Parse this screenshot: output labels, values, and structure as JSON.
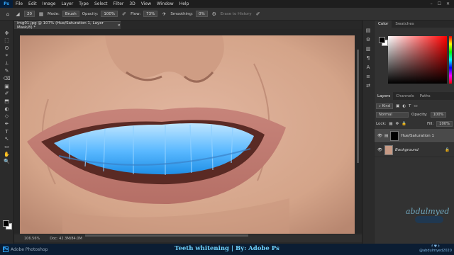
{
  "menubar": {
    "logo": "Ps",
    "items": [
      "File",
      "Edit",
      "Image",
      "Layer",
      "Type",
      "Select",
      "Filter",
      "3D",
      "View",
      "Window",
      "Help"
    ],
    "window_buttons": [
      "–",
      "☐",
      "✕"
    ]
  },
  "options": {
    "brush_size": "20",
    "mode_label": "Mode:",
    "mode_value": "Brush",
    "opacity_label": "Opacity:",
    "opacity_value": "100%",
    "flow_label": "Flow:",
    "flow_value": "73%",
    "smoothing_label": "Smoothing:",
    "smoothing_value": "0%",
    "erase_history": "Erase to History"
  },
  "tools": [
    "✥",
    "⬚",
    "ʘ",
    "⌖",
    "⟂",
    "✎",
    "⌫",
    "▣",
    "✐",
    "⬒",
    "◐",
    "◇",
    "✒",
    "T",
    "↖",
    "▭",
    "✋",
    "🔍"
  ],
  "document": {
    "tab_title": "img01.jpg @ 107% (Hue/Saturation 1, Layer Mask/8) *",
    "close": "×",
    "zoom": "106.56%",
    "doc_info": "Doc: 42.3M/84.0M"
  },
  "right_strip": [
    "▤",
    "⚙",
    "▥",
    "¶",
    "A",
    "≡",
    "⇄"
  ],
  "color_panel": {
    "tabs": [
      "Color",
      "Swatches"
    ],
    "active_tab": "Color"
  },
  "layers_panel": {
    "tabs": [
      "Layers",
      "Channels",
      "Paths"
    ],
    "active_tab": "Layers",
    "kind_label": "Kind",
    "blend_mode": "Normal",
    "opacity_label": "Opacity:",
    "opacity_value": "100%",
    "lock_label": "Lock:",
    "fill_label": "Fill:",
    "fill_value": "100%",
    "layers": [
      {
        "name": "Hue/Saturation 1",
        "active": true
      },
      {
        "name": "Background",
        "active": false
      }
    ]
  },
  "footer": {
    "brand": "Adobe Photoshop",
    "title": "Teeth whitening | By: Adobe Ps",
    "social_icons": "f ♥ t",
    "social_handle": "@abdulmyed2020"
  },
  "watermark": "abdulmyed",
  "colors": {
    "accent": "#31a8ff",
    "selected_teeth": "#3aa9ff",
    "footer_bg": "#0b1d33"
  }
}
